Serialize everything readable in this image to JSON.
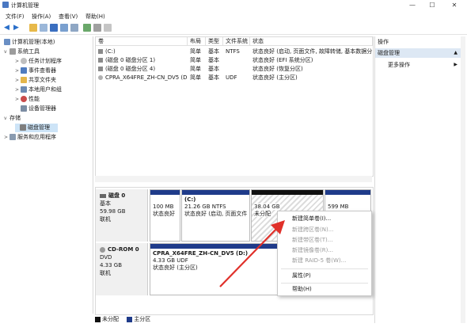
{
  "window": {
    "title": "计算机管理"
  },
  "menu": [
    "文件(F)",
    "操作(A)",
    "查看(V)",
    "帮助(H)"
  ],
  "tree": [
    {
      "label": "计算机管理(本地)",
      "level": 0,
      "arrow": "",
      "selected": false
    },
    {
      "label": "系统工具",
      "level": 1,
      "arrow": "v",
      "selected": false
    },
    {
      "label": "任务计划程序",
      "level": 2,
      "arrow": ">",
      "selected": false
    },
    {
      "label": "事件查看器",
      "level": 2,
      "arrow": ">",
      "selected": false
    },
    {
      "label": "共享文件夹",
      "level": 2,
      "arrow": ">",
      "selected": false
    },
    {
      "label": "本地用户和组",
      "level": 2,
      "arrow": ">",
      "selected": false
    },
    {
      "label": "性能",
      "level": 2,
      "arrow": ">",
      "selected": false
    },
    {
      "label": "设备管理器",
      "level": 2,
      "arrow": "",
      "selected": false
    },
    {
      "label": "存储",
      "level": 1,
      "arrow": "v",
      "selected": false
    },
    {
      "label": "磁盘管理",
      "level": 2,
      "arrow": "",
      "selected": true
    },
    {
      "label": "服务和应用程序",
      "level": 1,
      "arrow": ">",
      "selected": false
    }
  ],
  "volume_table": {
    "headers": [
      "卷",
      "布局",
      "类型",
      "文件系统",
      "状态"
    ],
    "rows": [
      [
        "(C:)",
        "简单",
        "基本",
        "NTFS",
        "状态良好 (启动, 页面文件, 故障转储, 基本数据分"
      ],
      [
        "(磁盘 0 磁盘分区 1)",
        "简单",
        "基本",
        "",
        "状态良好 (EFI 系统分区)"
      ],
      [
        "(磁盘 0 磁盘分区 4)",
        "简单",
        "基本",
        "",
        "状态良好 (恢复分区)"
      ],
      [
        "CPRA_X64FRE_ZH-CN_DV5 (D:)",
        "简单",
        "基本",
        "UDF",
        "状态良好 (主分区)"
      ]
    ]
  },
  "disks": [
    {
      "name": "磁盘 0",
      "type": "基本",
      "size": "59.98 GB",
      "status": "联机",
      "partitions": [
        {
          "size": "100 MB",
          "status": "状态良好",
          "label": ""
        },
        {
          "label": "(C:)",
          "size": "21.26 GB NTFS",
          "status": "状态良好 (启动, 页面文件"
        },
        {
          "size": "38.04 GB",
          "status": "未分配",
          "label": ""
        },
        {
          "size": "599 MB",
          "status": "",
          "label": ""
        }
      ]
    },
    {
      "name": "CD-ROM 0",
      "type": "DVD",
      "size": "4.33 GB",
      "status": "联机",
      "partitions": [
        {
          "label": "CPRA_X64FRE_ZH-CN_DV5 (D:)",
          "size": "4.33 GB UDF",
          "status": "状态良好 (主分区)"
        }
      ]
    }
  ],
  "legend": [
    "未分配",
    "主分区"
  ],
  "actions": {
    "header": "操作",
    "section": "磁盘管理",
    "more": "更多操作"
  },
  "context_menu": [
    {
      "label": "新建简单卷(I)...",
      "enabled": true
    },
    {
      "label": "新建跨区卷(N)...",
      "enabled": false
    },
    {
      "label": "新建带区卷(T)...",
      "enabled": false
    },
    {
      "label": "新建镜像卷(R)...",
      "enabled": false
    },
    {
      "label": "新建 RAID-5 卷(W)...",
      "enabled": false
    },
    {
      "label": "属性(P)",
      "enabled": true
    },
    {
      "label": "帮助(H)",
      "enabled": true
    }
  ],
  "colors": {
    "primary_partition": "#1f3b8a",
    "unallocated": "#111111",
    "arrow": "#e0302a",
    "selection": "#cde4f7"
  }
}
